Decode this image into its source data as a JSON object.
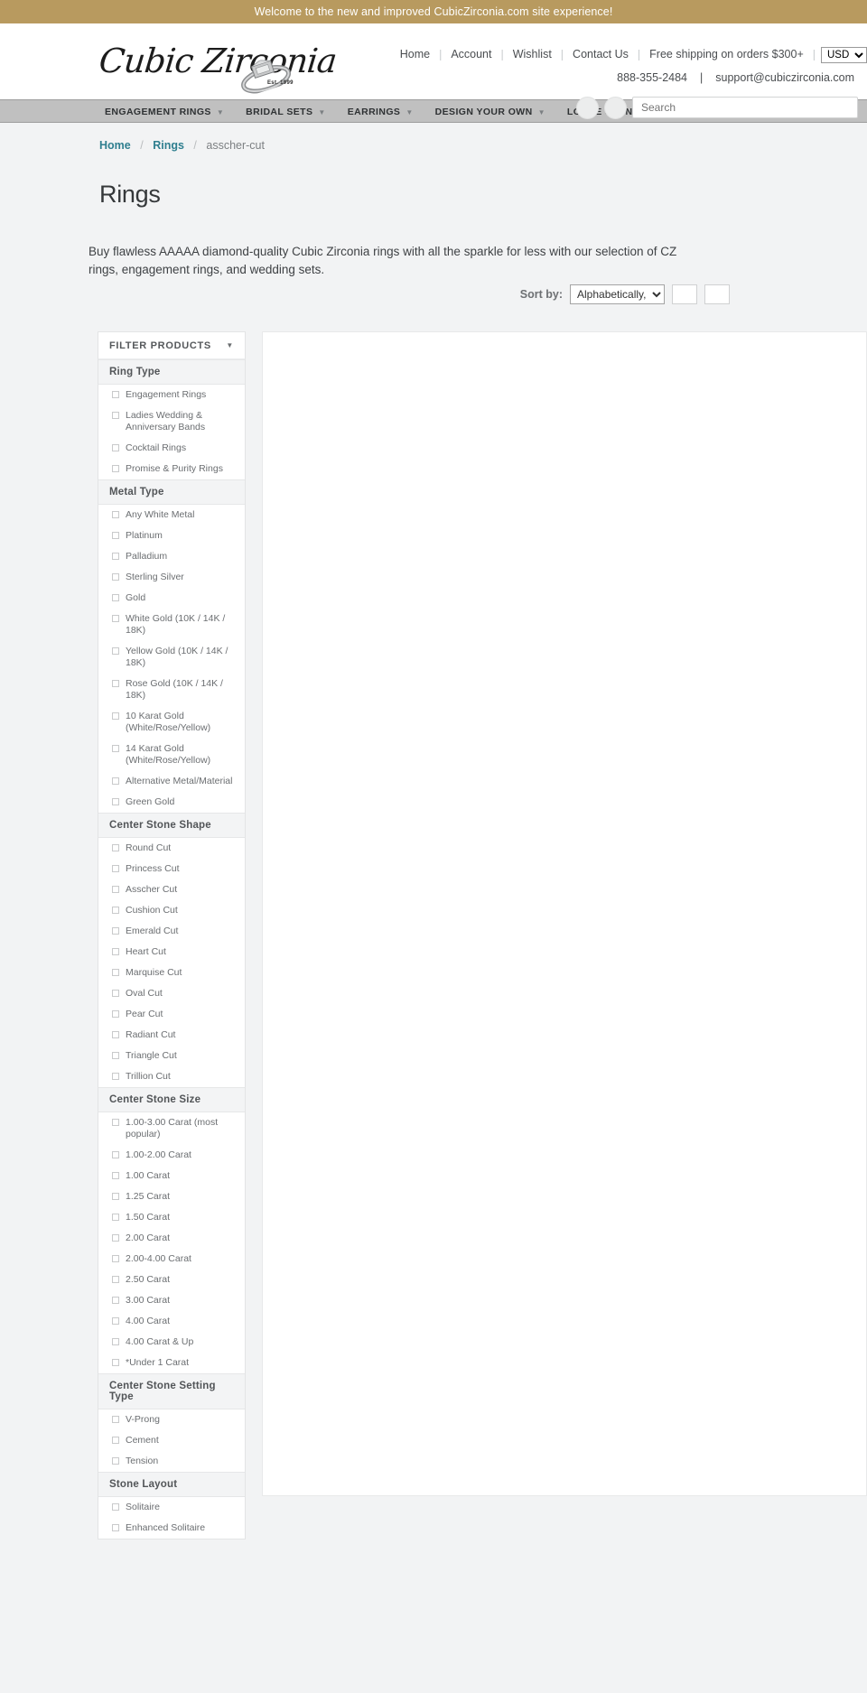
{
  "announcement": "Welcome to the new and improved CubicZirconia.com site experience!",
  "brand": {
    "name": "Cubic Zirconia",
    "established": "Est. 1999"
  },
  "header": {
    "top_links": [
      "Home",
      "Account",
      "Wishlist",
      "Contact Us",
      "Free shipping on orders $300+"
    ],
    "currency": "USD",
    "phone": "888-355-2484",
    "email": "support@cubiczirconia.com"
  },
  "nav": {
    "items": [
      "ENGAGEMENT RINGS",
      "BRIDAL SETS",
      "EARRINGS",
      "DESIGN YOUR OWN",
      "LOOSE STONES"
    ],
    "caret": "chevron-down-icon",
    "search_placeholder": "Search"
  },
  "breadcrumb": {
    "home": "Home",
    "rings": "Rings",
    "current": "asscher-cut"
  },
  "page": {
    "title": "Rings",
    "description": "Buy flawless AAAAA diamond-quality Cubic Zirconia rings with all the sparkle for less with our selection of CZ rings, engagement rings, and wedding sets."
  },
  "sort": {
    "label": "Sort by:",
    "selected": "Alphabetically, A-Z"
  },
  "filters": {
    "header": "FILTER PRODUCTS",
    "groups": [
      {
        "title": "Ring Type",
        "options": [
          "Engagement Rings",
          "Ladies Wedding & Anniversary Bands",
          "Cocktail Rings",
          "Promise & Purity Rings"
        ]
      },
      {
        "title": "Metal Type",
        "options": [
          "Any White Metal",
          "Platinum",
          "Palladium",
          "Sterling Silver",
          "Gold",
          "White Gold (10K / 14K / 18K)",
          "Yellow Gold (10K / 14K / 18K)",
          "Rose Gold (10K / 14K / 18K)",
          "10 Karat Gold (White/Rose/Yellow)",
          "14 Karat Gold (White/Rose/Yellow)",
          "Alternative Metal/Material",
          "Green Gold"
        ]
      },
      {
        "title": "Center Stone Shape",
        "options": [
          "Round Cut",
          "Princess Cut",
          "Asscher Cut",
          "Cushion Cut",
          "Emerald Cut",
          "Heart Cut",
          "Marquise Cut",
          "Oval Cut",
          "Pear Cut",
          "Radiant Cut",
          "Triangle Cut",
          "Trillion Cut"
        ]
      },
      {
        "title": "Center Stone Size",
        "options": [
          "1.00-3.00 Carat (most popular)",
          "1.00-2.00 Carat",
          "1.00 Carat",
          "1.25 Carat",
          "1.50 Carat",
          "2.00 Carat",
          "2.00-4.00 Carat",
          "2.50 Carat",
          "3.00 Carat",
          "4.00 Carat",
          "4.00 Carat & Up",
          "*Under 1 Carat"
        ]
      },
      {
        "title": "Center Stone Setting Type",
        "options": [
          "V-Prong",
          "Cement",
          "Tension"
        ]
      },
      {
        "title": "Stone Layout",
        "options": [
          "Solitaire",
          "Enhanced Solitaire"
        ]
      }
    ]
  },
  "colors": {
    "announcement_bg": "#b89a5f",
    "nav_bg": "#c0c0c0",
    "link_accent": "#2f7f8f",
    "page_bg": "#f2f3f4"
  }
}
